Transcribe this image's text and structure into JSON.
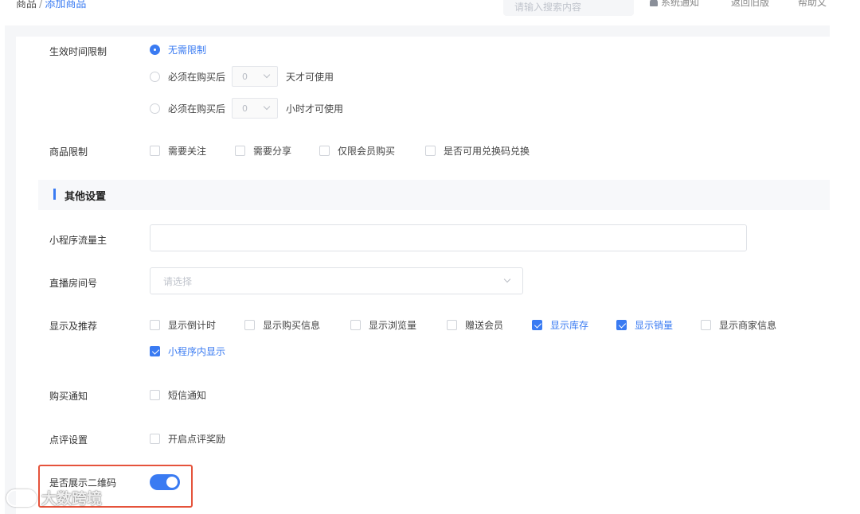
{
  "breadcrumb": {
    "root": "商品",
    "separator": "/",
    "current": "添加商品"
  },
  "header": {
    "search_placeholder": "请输入搜索内容",
    "notify_label": "系统通知",
    "back_label": "返回旧版",
    "help_label": "帮助文"
  },
  "validity": {
    "label": "生效时间限制",
    "options": [
      {
        "label": "无需限制",
        "checked": true
      },
      {
        "prefix": "必须在购买后",
        "value": "0",
        "suffix": "天才可使用",
        "checked": false
      },
      {
        "prefix": "必须在购买后",
        "value": "0",
        "suffix": "小时才可使用",
        "checked": false
      }
    ]
  },
  "product_limit": {
    "label": "商品限制",
    "options": [
      {
        "label": "需要关注",
        "checked": false
      },
      {
        "label": "需要分享",
        "checked": false
      },
      {
        "label": "仅限会员购买",
        "checked": false
      },
      {
        "label": "是否可用兑换码兑换",
        "checked": false
      }
    ]
  },
  "section": {
    "title": "其他设置"
  },
  "mini_program_owner": {
    "label": "小程序流量主",
    "value": ""
  },
  "live_room": {
    "label": "直播房间号",
    "placeholder": "请选择"
  },
  "display": {
    "label": "显示及推荐",
    "options": [
      {
        "label": "显示倒计时",
        "checked": false
      },
      {
        "label": "显示购买信息",
        "checked": false
      },
      {
        "label": "显示浏览量",
        "checked": false
      },
      {
        "label": "赠送会员",
        "checked": false
      },
      {
        "label": "显示库存",
        "checked": true
      },
      {
        "label": "显示销量",
        "checked": true
      },
      {
        "label": "显示商家信息",
        "checked": false
      },
      {
        "label": "小程序内显示",
        "checked": true
      }
    ]
  },
  "purchase_notify": {
    "label": "购买通知",
    "options": [
      {
        "label": "短信通知",
        "checked": false
      }
    ]
  },
  "review": {
    "label": "点评设置",
    "options": [
      {
        "label": "开启点评奖励",
        "checked": false
      }
    ]
  },
  "qrcode": {
    "label": "是否展示二维码",
    "enabled": true
  },
  "watermark": {
    "text": "大数跨境"
  },
  "colors": {
    "accent": "#3a7bf2",
    "highlight_border": "#e5533b"
  }
}
